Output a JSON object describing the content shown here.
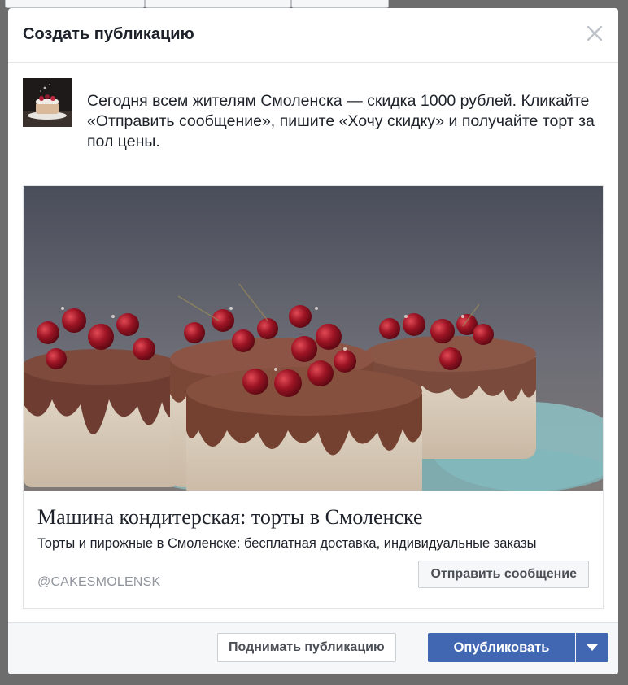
{
  "dialog": {
    "title": "Создать публикацию",
    "close_icon": "close-icon"
  },
  "post": {
    "avatar_icon": "cake-thumbnail",
    "message": "Сегодня всем жителям Смоленска — скидка 1000 рублей. Кликайте «Отправить сообщение», пишите «Хочу скидку» и получайте торт за пол цены."
  },
  "card": {
    "image": "cakes-with-berries-photo",
    "title": "Машина кондитерская: торты в Смоленске",
    "description": "Торты и пирожные в Смоленске: бесплатная доставка, индивидуальные заказы",
    "domain": "@CAKESMOLENSK",
    "cta_label": "Отправить сообщение"
  },
  "footer": {
    "boost_label": "Поднимать публикацию",
    "publish_label": "Опубликовать",
    "publish_dropdown_icon": "chevron-down-icon"
  },
  "colors": {
    "primary": "#4267b2",
    "overlay": "#6d6d6d",
    "text": "#1d2129",
    "muted": "#90949c"
  }
}
